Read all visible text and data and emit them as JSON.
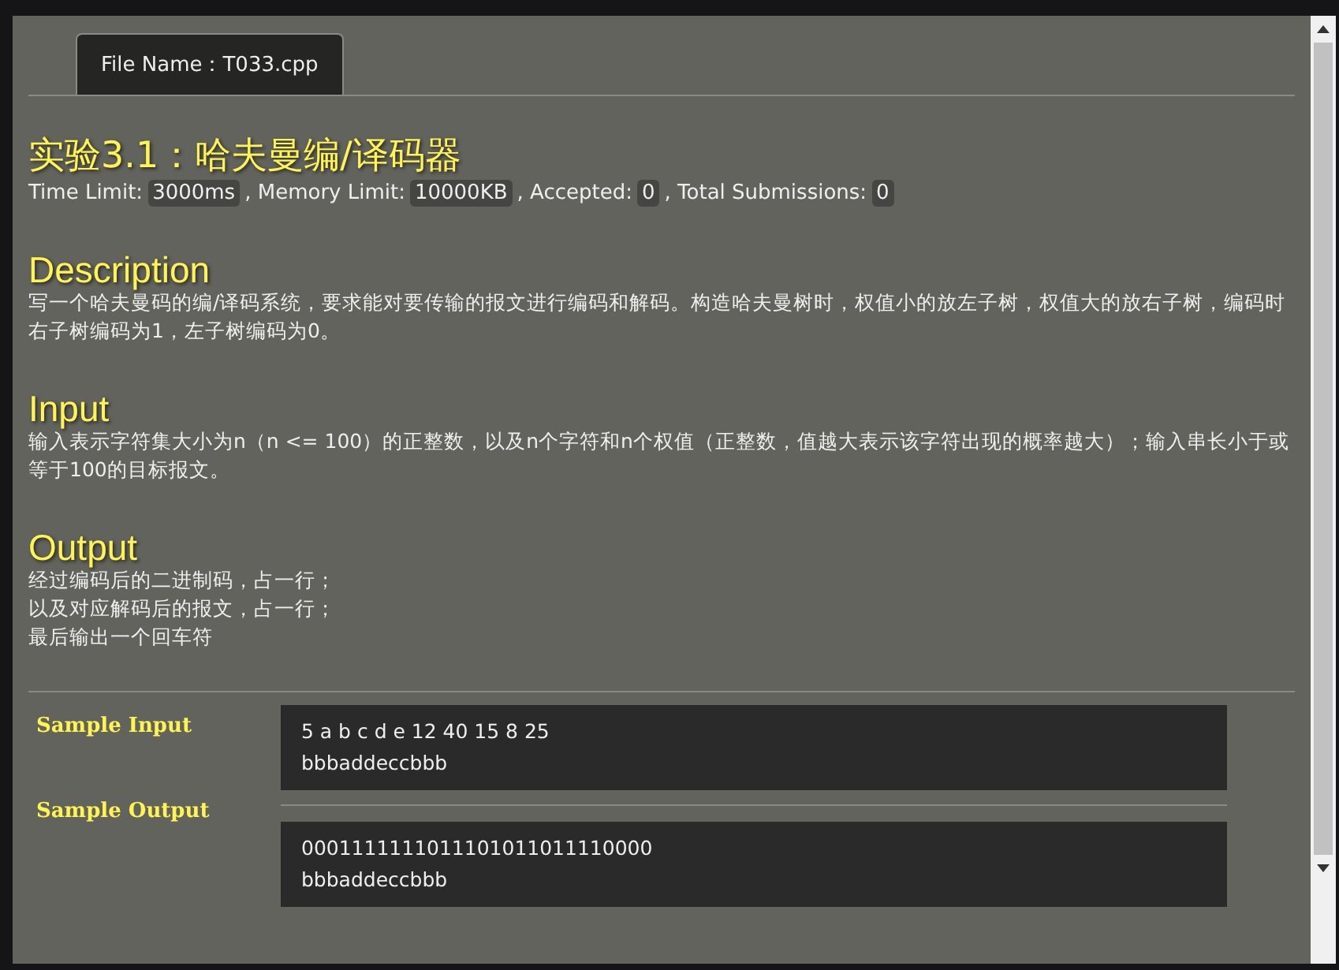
{
  "tab": {
    "label": "File Name：T033.cpp",
    "selected": true
  },
  "title": "实验3.1：哈夫曼编/译码器",
  "stats": [
    {
      "label": "Time Limit:",
      "value": "3000ms"
    },
    {
      "label": ", Memory Limit:",
      "value": "10000KB"
    },
    {
      "label": ", Accepted:",
      "value": "0"
    },
    {
      "label": ", Total Submissions:",
      "value": "0"
    }
  ],
  "sections": [
    {
      "heading": "Description",
      "lines": [
        "写一个哈夫曼码的编/译码系统，要求能对要传输的报文进行编码和解码。构造哈夫曼树时，权值小的放左子树，权值大的放右子树，编码时右子树编码为1，左子树编码为0。"
      ]
    },
    {
      "heading": "Input",
      "lines": [
        "输入表示字符集大小为n（n <= 100）的正整数，以及n个字符和n个权值（正整数，值越大表示该字符出现的概率越大）；输入串长小于或等于100的目标报文。"
      ]
    },
    {
      "heading": "Output",
      "lines": [
        "经过编码后的二进制码，占一行；",
        "以及对应解码后的报文，占一行；",
        "最后输出一个回车符"
      ]
    }
  ],
  "samples": [
    {
      "label": "Sample Input",
      "lines": [
        "5 a b c d e 12 40 15 8 25",
        "bbbaddeccbbb"
      ]
    },
    {
      "label": "Sample Output",
      "lines": [
        "0001111111011101011011110000",
        "bbbaddeccbbb"
      ]
    }
  ]
}
